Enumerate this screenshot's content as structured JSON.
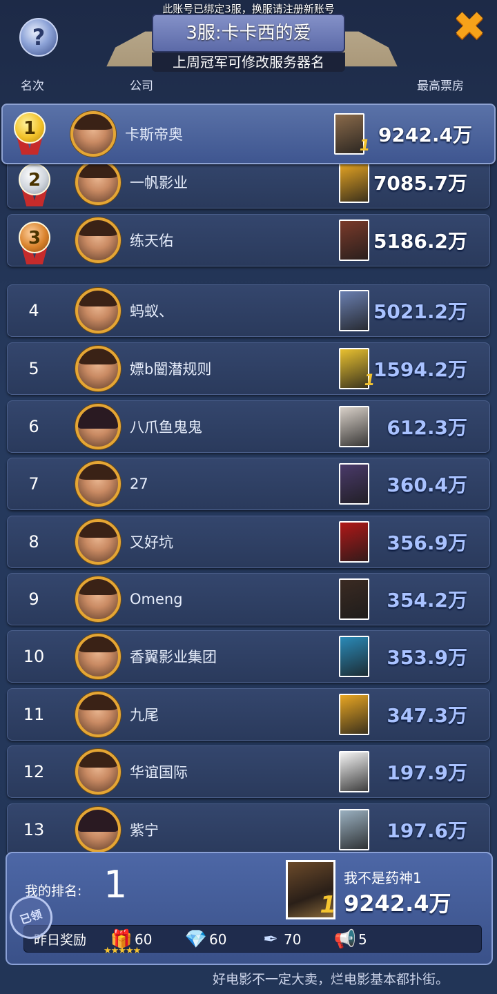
{
  "header": {
    "notice": "此账号已绑定3服，换服请注册新账号",
    "server_title": "3服:卡卡西的爱",
    "server_subtitle": "上周冠军可修改服务器名",
    "help_icon_glyph": "?",
    "close_icon_glyph": "✖"
  },
  "columns": {
    "rank": "名次",
    "company": "公司",
    "top_box_office": "最高票房"
  },
  "rows": [
    {
      "rank": "1",
      "company": "卡斯帝奥",
      "box_office": "9242.4万",
      "medal": "gold",
      "poster_color": "#8a6a4a",
      "badge": "1"
    },
    {
      "rank": "2",
      "company": "一帆影业",
      "box_office": "7085.7万",
      "medal": "silver",
      "poster_color": "#e8a623",
      "badge": ""
    },
    {
      "rank": "3",
      "company": "练天佑",
      "box_office": "5186.2万",
      "medal": "bronze",
      "poster_color": "#7a3a2a",
      "badge": ""
    },
    {
      "rank": "4",
      "company": "蚂蚁、",
      "box_office": "5021.2万",
      "medal": "",
      "poster_color": "#6a7fb0",
      "badge": ""
    },
    {
      "rank": "5",
      "company": "嫖b闓潜规则",
      "box_office": "1594.2万",
      "medal": "",
      "poster_color": "#e8c030",
      "badge": "1"
    },
    {
      "rank": "6",
      "company": "八爪鱼鬼鬼",
      "box_office": "612.3万",
      "medal": "",
      "poster_color": "#d8d0c8",
      "badge": ""
    },
    {
      "rank": "7",
      "company": "27",
      "box_office": "360.4万",
      "medal": "",
      "poster_color": "#4a3a6a",
      "badge": ""
    },
    {
      "rank": "8",
      "company": "又好坑",
      "box_office": "356.9万",
      "medal": "",
      "poster_color": "#b01818",
      "badge": ""
    },
    {
      "rank": "9",
      "company": "Omeng",
      "box_office": "354.2万",
      "medal": "",
      "poster_color": "#3a2a22",
      "badge": ""
    },
    {
      "rank": "10",
      "company": "香翼影业集团",
      "box_office": "353.9万",
      "medal": "",
      "poster_color": "#2a8ab8",
      "badge": ""
    },
    {
      "rank": "11",
      "company": "九尾",
      "box_office": "347.3万",
      "medal": "",
      "poster_color": "#e8a623",
      "badge": ""
    },
    {
      "rank": "12",
      "company": "华谊国际",
      "box_office": "197.9万",
      "medal": "",
      "poster_color": "#f4f4f4",
      "badge": ""
    },
    {
      "rank": "13",
      "company": "紫宁",
      "box_office": "197.6万",
      "medal": "",
      "poster_color": "#9ab0c0",
      "badge": ""
    }
  ],
  "my_rank": {
    "label": "我的排名:",
    "rank": "1",
    "movie": "我不是药神1",
    "box_office": "9242.4万",
    "poster_badge": "1",
    "claimed_stamp": "已领"
  },
  "rewards": {
    "label": "昨日奖励",
    "items": [
      {
        "icon": "gift-icon",
        "glyph": "🎁",
        "value": "60"
      },
      {
        "icon": "diamond-icon",
        "glyph": "💎",
        "value": "60"
      },
      {
        "icon": "quill-icon",
        "glyph": "✒",
        "value": "70"
      },
      {
        "icon": "megaphone-icon",
        "glyph": "📢",
        "value": "5"
      }
    ],
    "stars": "★★★★★"
  },
  "footer": "好电影不一定大卖，烂电影基本都扑街。",
  "colors": {
    "accent_gold": "#e5a634",
    "value_blue": "#a9c2ff",
    "close_orange": "#f7a21a"
  }
}
